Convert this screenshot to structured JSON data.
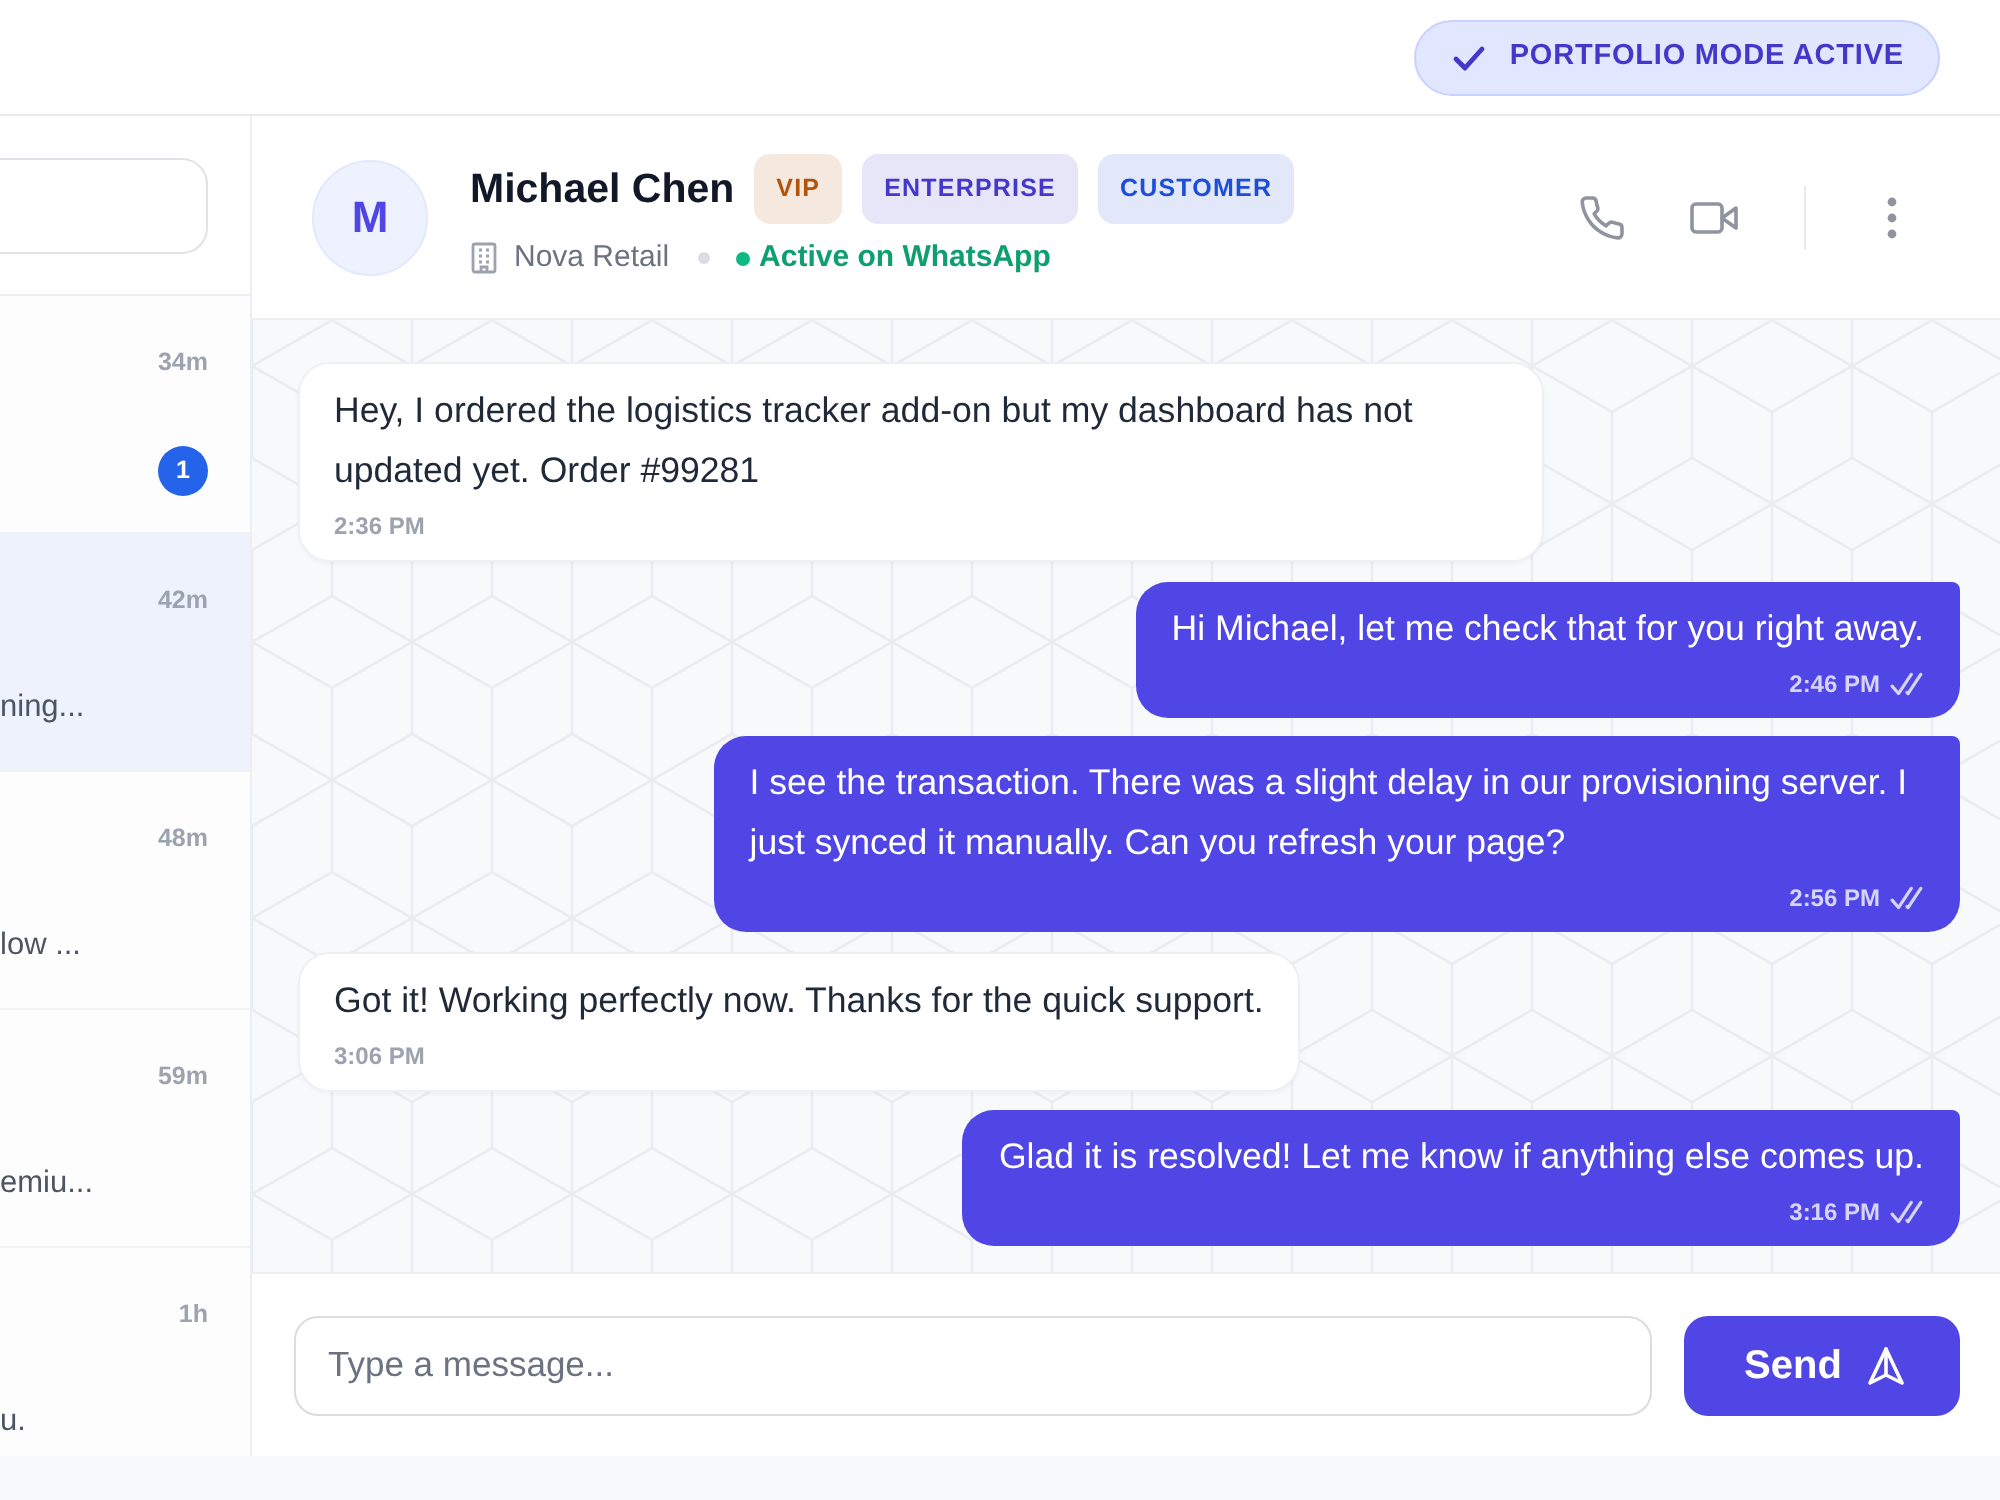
{
  "top_bar": {
    "mode_status": "PORTFOLIO MODE ACTIVE"
  },
  "sidebar": {
    "conversations": [
      {
        "time": "34m",
        "unread": "1",
        "selected": false
      },
      {
        "time": "42m",
        "preview": "ning...",
        "selected": true
      },
      {
        "time": "48m",
        "preview": "low ...",
        "selected": false
      },
      {
        "time": "59m",
        "preview": "emiu...",
        "selected": false
      },
      {
        "time": "1h",
        "preview": "u.",
        "selected": false
      }
    ]
  },
  "chat": {
    "contact": {
      "initial": "M",
      "name": "Michael Chen",
      "tags": [
        {
          "label": "VIP",
          "color": "#b45309"
        },
        {
          "label": "ENTERPRISE",
          "color": "#4338ca"
        },
        {
          "label": "CUSTOMER",
          "color": "#1d4ed8"
        }
      ],
      "company": "Nova Retail",
      "online": true,
      "status": "Active on WhatsApp"
    },
    "messages": [
      {
        "kind": "incoming",
        "text": "Hey, I ordered the logistics tracker add-on but my dashboard has not updated yet. Order #99281",
        "time": "2:36 PM"
      },
      {
        "kind": "outgoing",
        "text": "Hi Michael, let me check that for you right away.",
        "time": "2:46 PM"
      },
      {
        "kind": "outgoing",
        "text": "I see the transaction. There was a slight delay in our provisioning server. I just synced it manually. Can you refresh your page?",
        "time": "2:56 PM"
      },
      {
        "kind": "incoming",
        "text": "Got it! Working perfectly now. Thanks for the quick support.",
        "time": "3:06 PM"
      },
      {
        "kind": "outgoing",
        "text": "Glad it is resolved! Let me know if anything else comes up.",
        "time": "3:16 PM"
      }
    ],
    "composer": {
      "placeholder": "Type a message...",
      "send_label": "Send"
    }
  }
}
